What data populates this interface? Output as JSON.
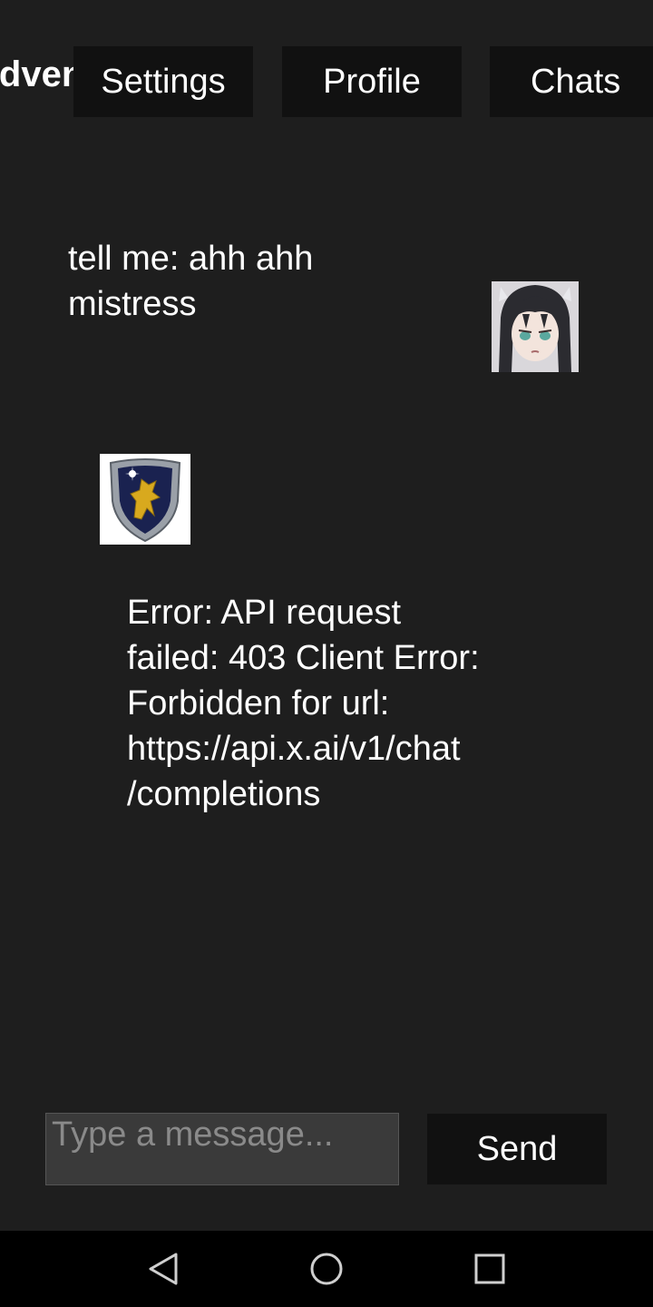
{
  "app": {
    "title": "Adventure"
  },
  "header": {
    "tabs": [
      {
        "label": "Settings"
      },
      {
        "label": "Profile"
      },
      {
        "label": "Chats"
      }
    ]
  },
  "messages": [
    {
      "role": "user",
      "text": "tell me: ahh ahh\nmistress",
      "avatar_icon": "user-anime-avatar"
    },
    {
      "role": "assistant",
      "text": "Error: API request\nfailed: 403 Client Error:\nForbidden for url:\nhttps://api.x.ai/v1/chat\n/completions",
      "avatar_icon": "griffin-shield-avatar"
    }
  ],
  "composer": {
    "placeholder": "Type a message...",
    "value": "",
    "send_label": "Send"
  },
  "system_nav": {
    "icons": [
      "back-icon",
      "home-icon",
      "recents-icon"
    ]
  },
  "colors": {
    "background": "#1e1e1e",
    "button_bg": "#111111",
    "input_bg": "#3a3a3a",
    "navbar_bg": "#000000"
  }
}
